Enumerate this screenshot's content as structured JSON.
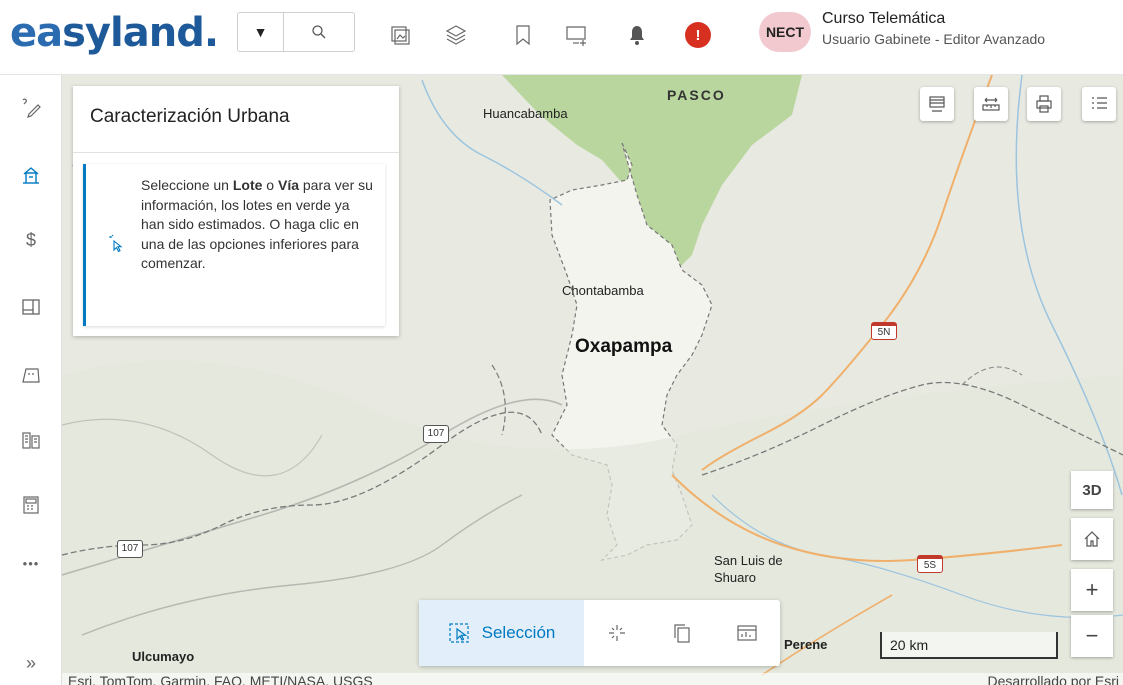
{
  "header": {
    "logo": {
      "part1": "ea",
      "part2": "sy",
      "part3": "land."
    },
    "search": {
      "dropdown_icon": "caret-down-icon",
      "button_icon": "search-icon"
    },
    "toolbar_icons": [
      "layout-icon",
      "layers-icon",
      "bookmark-icon",
      "add-screen-icon",
      "bell-icon"
    ],
    "alert_badge": "!",
    "user": {
      "initials": "NECT",
      "name": "Curso Telemática",
      "role": "Usuario Gabinete - Editor Avanzado"
    },
    "colors": {
      "logo_blue": "#2b6cb0",
      "alert": "#d83020",
      "avatar_bg": "#f1c9cf"
    }
  },
  "sidebar": {
    "items": [
      "measure-icon",
      "urban-icon",
      "dollar-icon",
      "map-layout-icon",
      "parcel-icon",
      "buildings-icon",
      "calculator-icon",
      "more-icon"
    ],
    "more_label": "•••",
    "expand_label": "»"
  },
  "panel": {
    "title": "Caracterización Urbana",
    "notice": {
      "t1": "Seleccione un ",
      "b1": "Lote",
      "t2": " o ",
      "b2": "Vía",
      "t3": " para ver su información, los lotes en verde ya han sido estimados. O haga clic en una de las opciones inferiores para comenzar."
    }
  },
  "map": {
    "labels": {
      "huancabamba": "Huancabamba",
      "pasco": "PASCO",
      "chontabamba": "Chontabamba",
      "oxapampa": "Oxapampa",
      "san_luis": "San Luis de",
      "shuaro": "Shuaro",
      "ulcumayo": "Ulcumayo",
      "perene": "Perene",
      "r107a": "107",
      "r107b": "107",
      "r5n": "5N",
      "r5s": "5S"
    },
    "controls": {
      "three_d": "3D",
      "home_icon": "home-icon",
      "zoom_in": "+",
      "zoom_out": "−"
    },
    "top_buttons": [
      "basemap-icon",
      "measure-distance-icon",
      "print-icon",
      "legend-icon"
    ],
    "scalebar": "20 km",
    "attribution_left": "Esri, TomTom, Garmin, FAO, METI/NASA, USGS",
    "attribution_right": "Desarrollado por Esri",
    "colors": {
      "district": "#f4f4ef",
      "pasco": "#b9d59e",
      "accent": "#007ac2"
    }
  },
  "bottom_toolbar": {
    "selection_label": "Selección",
    "tools": [
      "selection-icon",
      "magic-wand-icon",
      "copy-icon",
      "dashboard-icon"
    ]
  }
}
